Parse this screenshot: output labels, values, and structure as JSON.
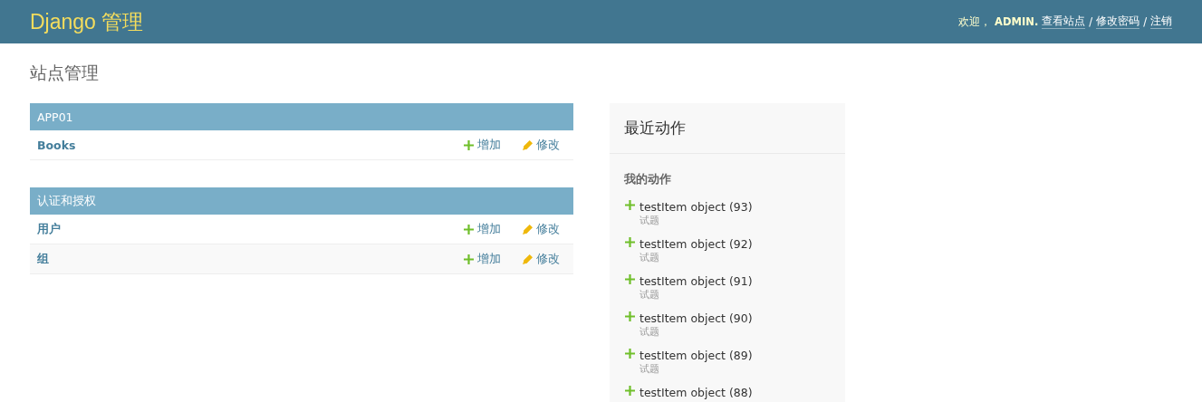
{
  "header": {
    "brand": "Django 管理",
    "welcome": "欢迎，",
    "user": "ADMIN",
    "user_end": ".",
    "links": [
      "查看站点",
      "修改密码",
      "注销"
    ],
    "separators": [
      "/",
      "/"
    ]
  },
  "page_title": "站点管理",
  "modules": [
    {
      "caption": "APP01",
      "models": [
        {
          "name": "Books",
          "add": "增加",
          "change": "修改"
        }
      ]
    },
    {
      "caption": "认证和授权",
      "models": [
        {
          "name": "用户",
          "add": "增加",
          "change": "修改"
        },
        {
          "name": "组",
          "add": "增加",
          "change": "修改"
        }
      ]
    }
  ],
  "recent_actions": {
    "title": "最近动作",
    "subtitle": "我的动作",
    "items": [
      {
        "kind": "addition",
        "name": "testItem object (93)",
        "type": "试题"
      },
      {
        "kind": "addition",
        "name": "testItem object (92)",
        "type": "试题"
      },
      {
        "kind": "addition",
        "name": "testItem object (91)",
        "type": "试题"
      },
      {
        "kind": "addition",
        "name": "testItem object (90)",
        "type": "试题"
      },
      {
        "kind": "addition",
        "name": "testItem object (89)",
        "type": "试题"
      },
      {
        "kind": "addition",
        "name": "testItem object (88)"
      }
    ]
  }
}
